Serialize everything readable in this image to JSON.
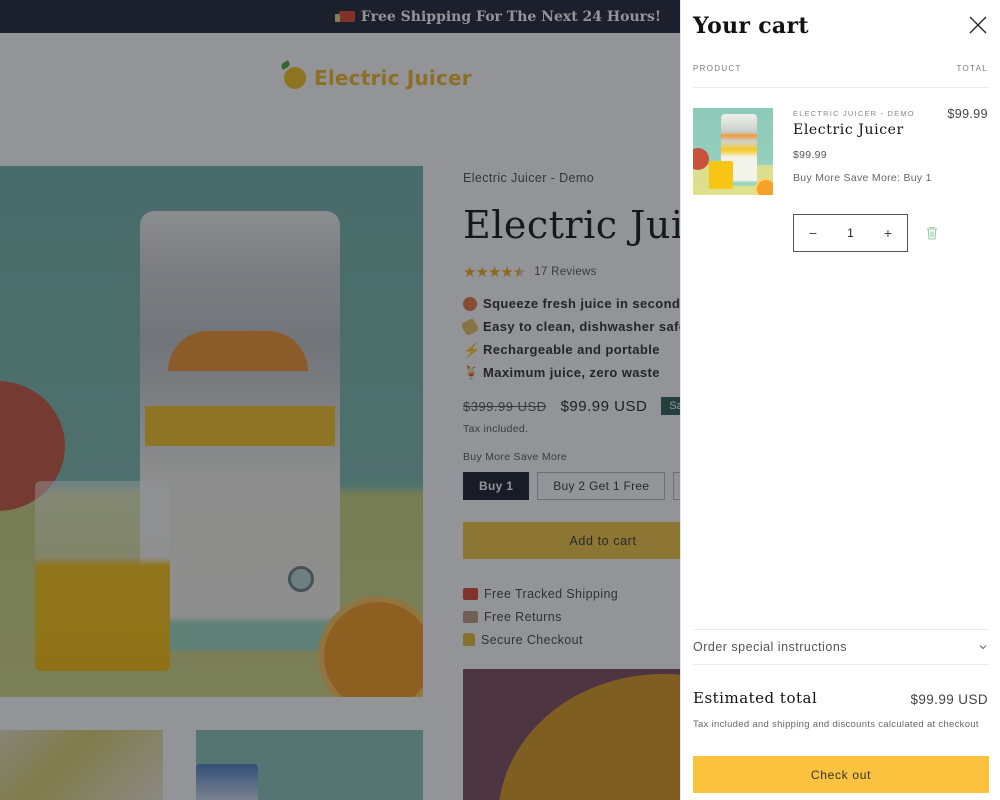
{
  "announcement": {
    "icon": "delivery-truck-icon",
    "text": "Free Shipping For The Next 24 Hours!"
  },
  "brand": {
    "logo_icon": "orange-fruit-icon",
    "name": "Electric Juicer",
    "color": "#f2b824"
  },
  "product": {
    "vendor": "Electric Juicer - Demo",
    "title": "Electric Juicer",
    "rating": 4.5,
    "rating_max": 5,
    "reviews_label": "17 Reviews",
    "features": [
      {
        "icon": "orange-icon",
        "text": "Squeeze fresh juice in seconds"
      },
      {
        "icon": "sponge-icon",
        "text": "Easy to clean, dishwasher safe"
      },
      {
        "icon": "lightning-icon",
        "text": "Rechargeable and portable"
      },
      {
        "icon": "tropical-drink-icon",
        "text": "Maximum juice, zero waste"
      }
    ],
    "compare_price": "$399.99 USD",
    "price": "$99.99 USD",
    "sale_badge": "Sale",
    "tax_note": "Tax included.",
    "bundle_label": "Buy More Save More",
    "variants": [
      {
        "label": "Buy 1",
        "selected": true
      },
      {
        "label": "Buy 2 Get 1 Free",
        "selected": false
      },
      {
        "label": "",
        "selected": false
      }
    ],
    "add_to_cart_label": "Add to cart",
    "trust_badges": [
      {
        "icon": "truck-icon",
        "text": "Free Tracked Shipping"
      },
      {
        "icon": "box-icon",
        "text": "Free Returns"
      },
      {
        "icon": "lock-icon",
        "text": "Secure Checkout"
      }
    ]
  },
  "cart": {
    "title": "Your cart",
    "close_icon": "close-icon",
    "columns": {
      "product": "PRODUCT",
      "total": "TOTAL"
    },
    "items": [
      {
        "vendor": "ELECTRIC JUICER - DEMO",
        "name": "Electric Juicer",
        "price": "$99.99",
        "option": "Buy More Save More: Buy 1",
        "quantity": "1",
        "line_total": "$99.99",
        "decrease_label": "−",
        "increase_label": "+"
      }
    ],
    "special_instructions_label": "Order special instructions",
    "estimated_total_label": "Estimated total",
    "estimated_total_value": "$99.99 USD",
    "tax_note": "Tax included and shipping and discounts calculated at checkout",
    "checkout_label": "Check out",
    "accent_color": "#fac23f"
  }
}
